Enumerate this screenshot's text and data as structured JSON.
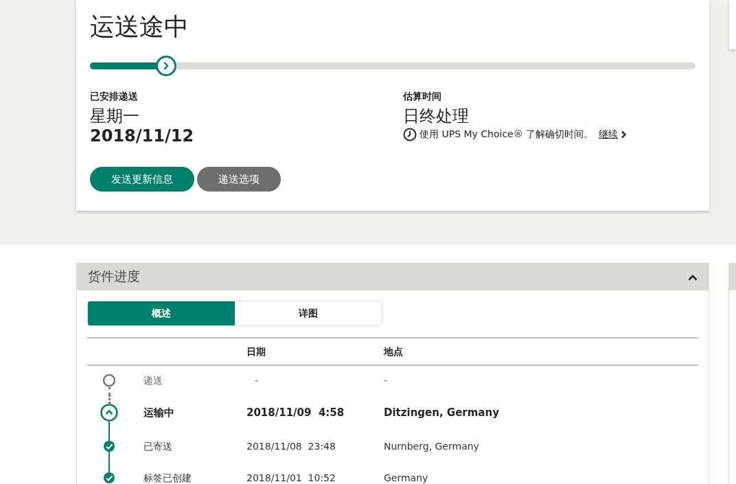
{
  "status_card": {
    "title": "运送途中",
    "progress": {
      "level": 0.126
    },
    "scheduled": {
      "label": "已安排递送",
      "day": "星期一",
      "date": "2018/11/12"
    },
    "estimate": {
      "label": "估算时间",
      "value": "日终处理",
      "note": "使用 UPS My Choice® 了解确切时间。",
      "link": "继续"
    },
    "buttons": [
      {
        "label": "发送更新信息",
        "kind": "primary"
      },
      {
        "label": "递送选项",
        "kind": "secondary"
      }
    ]
  },
  "progress_panel": {
    "title": "货件进度",
    "expanded": true,
    "tabs": [
      {
        "label": "概述",
        "selected": true
      },
      {
        "label": "详图",
        "selected": false
      }
    ],
    "columns": [
      "日期",
      "地点"
    ],
    "events": [
      {
        "status": "递送",
        "date": "-",
        "location": "-",
        "kind": "pending"
      },
      {
        "status": "运输中",
        "date": "2018/11/09  4:58",
        "location": "Ditzingen, Germany",
        "kind": "current"
      },
      {
        "status": "已寄送",
        "date": "2018/11/08  23:48",
        "location": "Nurnberg, Germany",
        "kind": "done"
      },
      {
        "status": "标签已创建",
        "date": "2018/11/01  10:52",
        "location": "Germany",
        "kind": "done"
      }
    ]
  }
}
